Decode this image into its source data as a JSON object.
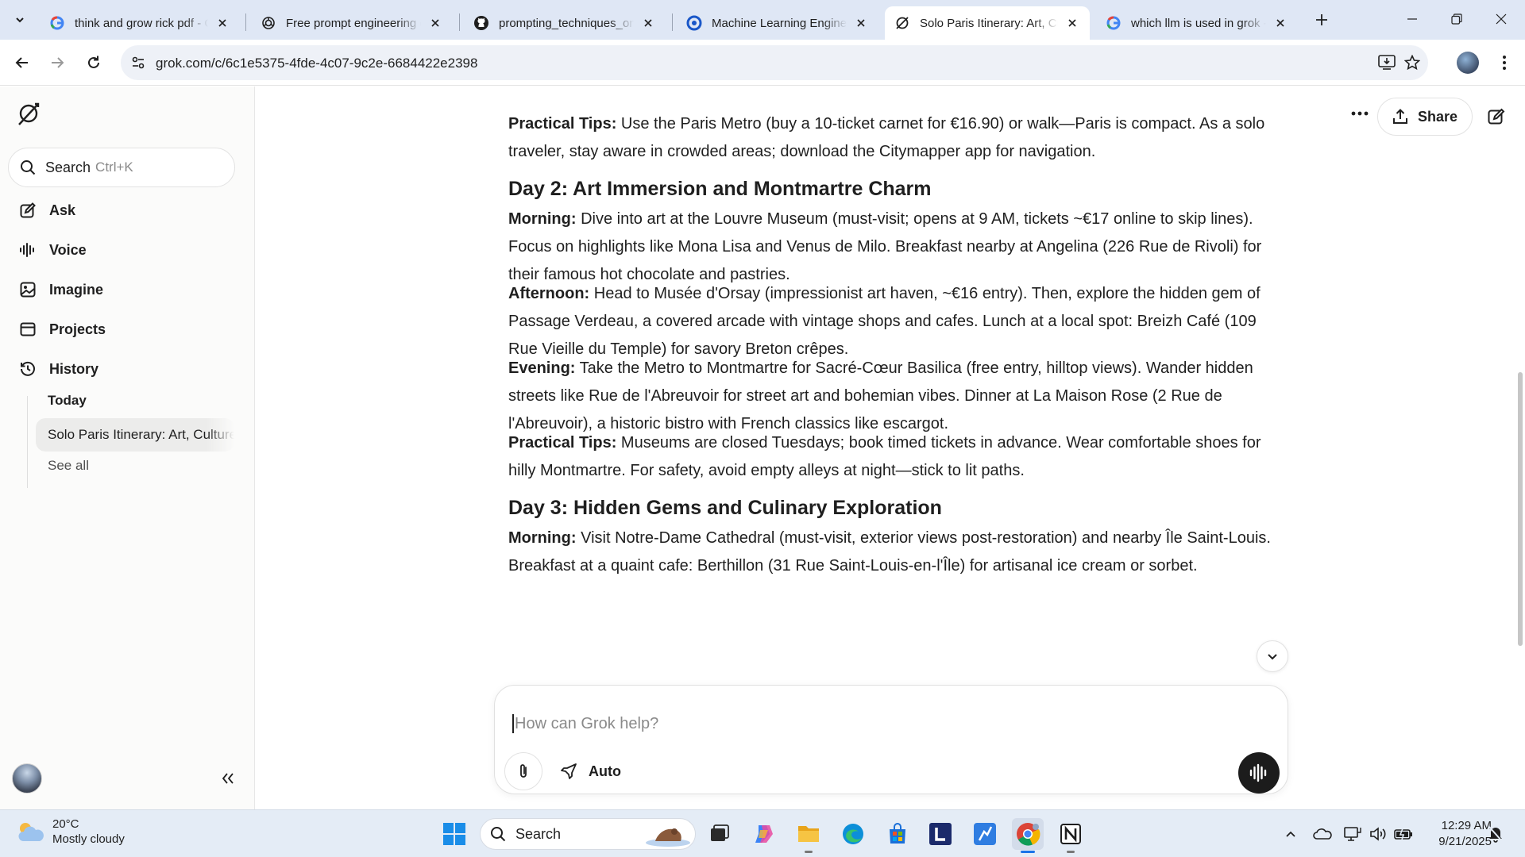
{
  "browser": {
    "tabs": [
      {
        "title": "think and grow rick pdf - Google Search",
        "favicon": "google-icon",
        "active": false
      },
      {
        "title": "Free prompt engineering courses",
        "favicon": "openai-icon",
        "active": false
      },
      {
        "title": "prompting_techniques_on_github",
        "favicon": "github-icon",
        "active": false
      },
      {
        "title": "Machine Learning Engineer",
        "favicon": "globe-icon",
        "active": false
      },
      {
        "title": "Solo Paris Itinerary: Art, Culture",
        "favicon": "grok-icon",
        "active": true
      },
      {
        "title": "which llm is used in grok - Google Search",
        "favicon": "google-icon",
        "active": false
      }
    ],
    "url": "grok.com/c/6c1e5375-4fde-4c07-9c2e-6684422e2398"
  },
  "sidebar": {
    "search_label": "Search",
    "search_shortcut": "Ctrl+K",
    "items": [
      {
        "label": "Ask",
        "icon": "ask-icon"
      },
      {
        "label": "Voice",
        "icon": "voice-wave-icon"
      },
      {
        "label": "Imagine",
        "icon": "image-icon"
      },
      {
        "label": "Projects",
        "icon": "folder-icon"
      },
      {
        "label": "History",
        "icon": "history-icon"
      }
    ],
    "history_group": "Today",
    "history_item": "Solo Paris Itinerary: Art, Culture",
    "see_all": "See all"
  },
  "header": {
    "share_label": "Share"
  },
  "article": {
    "tips1_label": "Practical Tips:",
    "tips1_text": " Use the Paris Metro (buy a 10-ticket carnet for €16.90) or walk—Paris is compact. As a solo traveler, stay aware in crowded areas; download the Citymapper app for navigation.",
    "day2_heading": "Day 2: Art Immersion and Montmartre Charm",
    "day2_morning_label": "Morning:",
    "day2_morning_text": " Dive into art at the Louvre Museum (must-visit; opens at 9 AM, tickets ~€17 online to skip lines). Focus on highlights like Mona Lisa and Venus de Milo. Breakfast nearby at Angelina (226 Rue de Rivoli) for their famous hot chocolate and pastries.",
    "day2_afternoon_label": "Afternoon:",
    "day2_afternoon_text": " Head to Musée d'Orsay (impressionist art haven, ~€16 entry). Then, explore the hidden gem of Passage Verdeau, a covered arcade with vintage shops and cafes. Lunch at a local spot: Breizh Café (109 Rue Vieille du Temple) for savory Breton crêpes.",
    "day2_evening_label": "Evening:",
    "day2_evening_text": " Take the Metro to Montmartre for Sacré-Cœur Basilica (free entry, hilltop views). Wander hidden streets like Rue de l'Abreuvoir for street art and bohemian vibes. Dinner at La Maison Rose (2 Rue de l'Abreuvoir), a historic bistro with French classics like escargot.",
    "tips2_label": "Practical Tips:",
    "tips2_text": " Museums are closed Tuesdays; book timed tickets in advance. Wear comfortable shoes for hilly Montmartre. For safety, avoid empty alleys at night—stick to lit paths.",
    "day3_heading": "Day 3: Hidden Gems and Culinary Exploration",
    "day3_morning_label": "Morning:",
    "day3_morning_text": " Visit Notre-Dame Cathedral (must-visit, exterior views post-restoration) and nearby Île Saint-Louis. Breakfast at a quaint cafe: Berthillon (31 Rue Saint-Louis-en-l'Île) for artisanal ice cream or sorbet."
  },
  "composer": {
    "placeholder": "How can Grok help?",
    "mode_label": "Auto"
  },
  "taskbar": {
    "temperature": "20°C",
    "condition": "Mostly cloudy",
    "search_label": "Search",
    "time": "12:29 AM",
    "date": "9/21/2025"
  },
  "colors": {
    "tabstrip": "#dfe7f5",
    "omnibox": "#eef1f7",
    "sidebar": "#fbfbfa",
    "active_history": "#ececeb",
    "voice_button": "#1c1c1c",
    "taskbar": "#e4ecf6"
  }
}
